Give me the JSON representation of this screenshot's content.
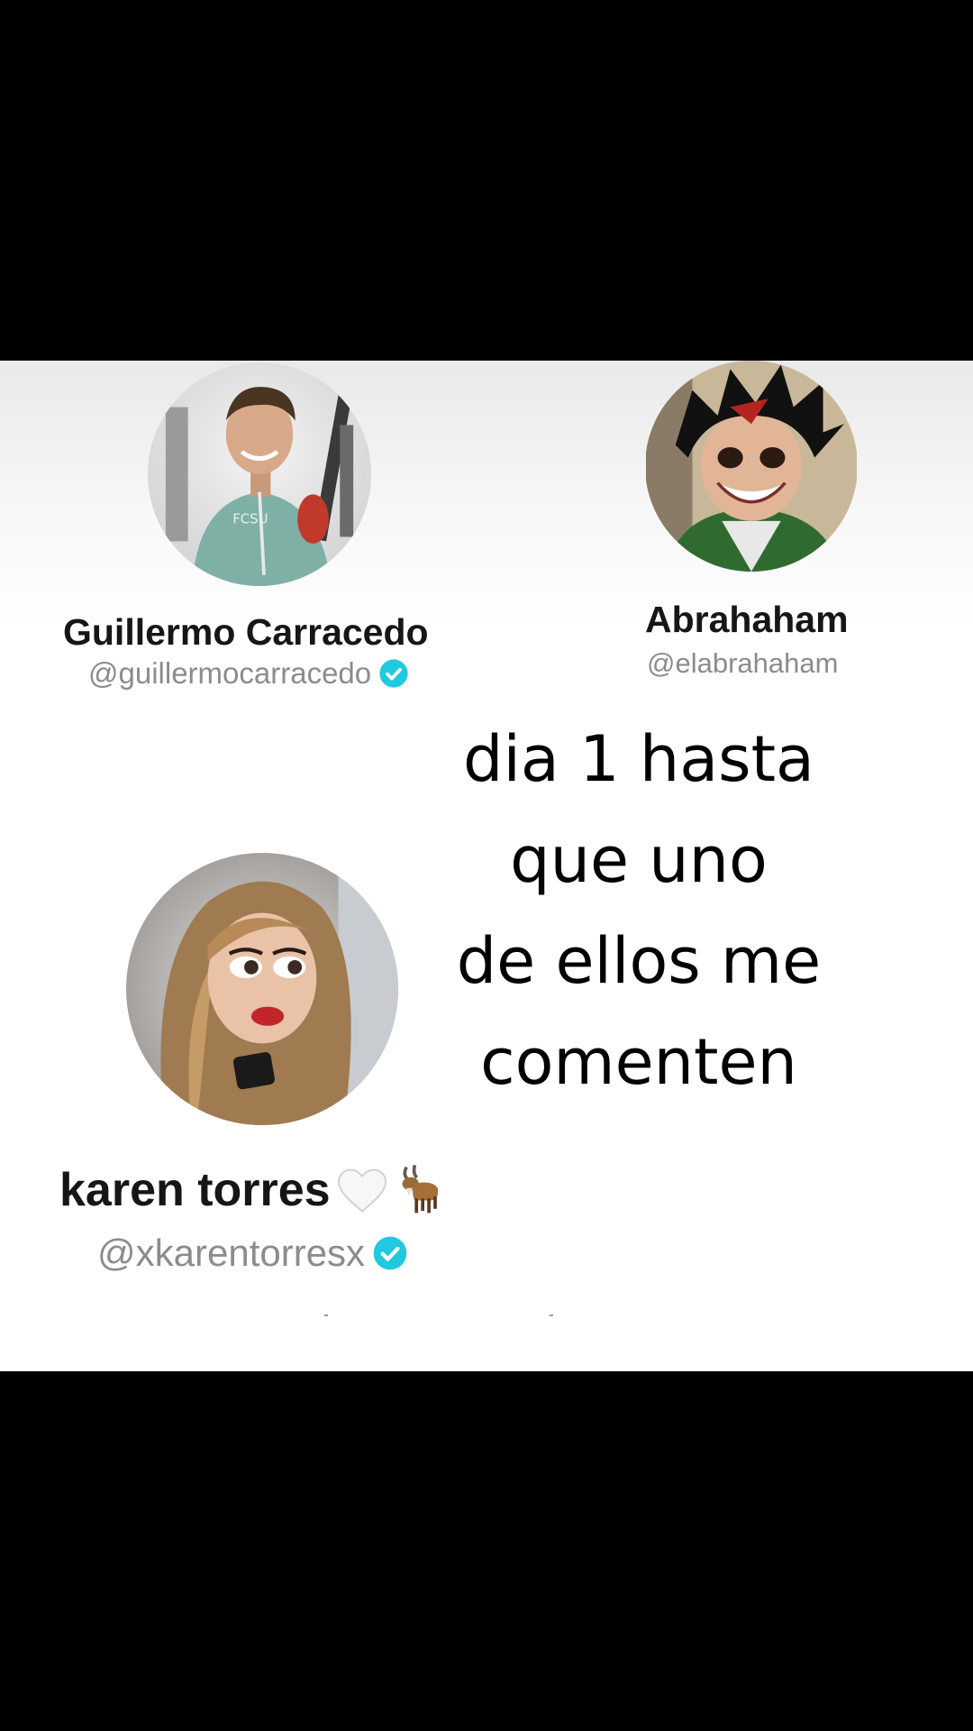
{
  "profiles": [
    {
      "name": "Guillermo Carracedo",
      "handle": "@guillermocarracedo",
      "verified": true,
      "avatar_icon": "avatar-photo-icon"
    },
    {
      "name": "Abrahaham",
      "handle": "@elabrahaham",
      "verified": false,
      "avatar_icon": "avatar-photo-icon"
    },
    {
      "name": "karen torres",
      "handle": "@xkarentorresx",
      "verified": true,
      "avatar_icon": "avatar-doll-icon",
      "name_emojis": [
        "white-heart-icon",
        "goat-icon"
      ]
    }
  ],
  "caption": {
    "lines": [
      "dia 1 hasta",
      "que uno",
      "de ellos me",
      "comenten"
    ]
  },
  "colors": {
    "background": "#000000",
    "panel": "#ffffff",
    "verified_badge": "#20c8e0",
    "name_text": "#161616",
    "handle_text": "#8c8c8c"
  }
}
